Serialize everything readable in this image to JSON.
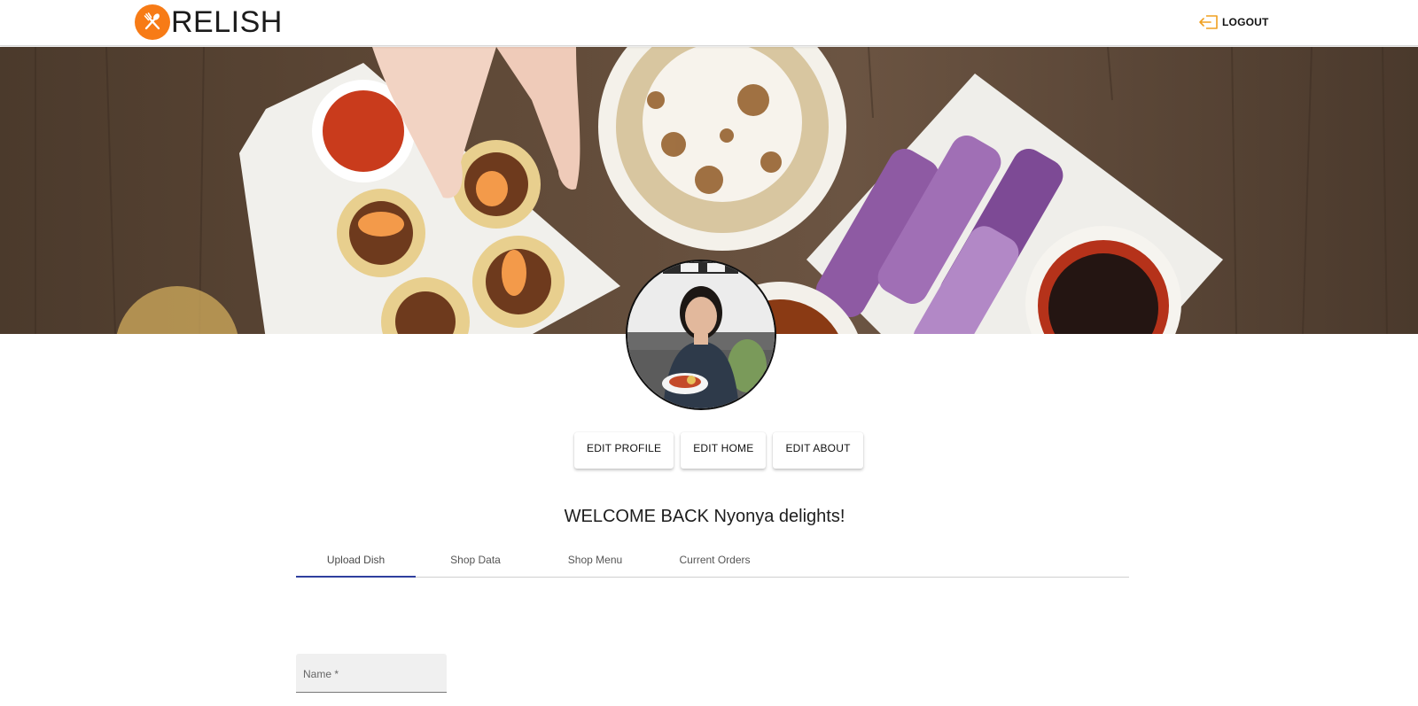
{
  "header": {
    "brand": "RELISH",
    "logout_label": "LOGOUT",
    "accent_color": "#f77b16"
  },
  "profile": {
    "edit_buttons": [
      "EDIT PROFILE",
      "EDIT HOME",
      "EDIT ABOUT"
    ]
  },
  "welcome": "WELCOME BACK Nyonya delights!",
  "tabs": [
    {
      "label": "Upload Dish",
      "active": true
    },
    {
      "label": "Shop Data",
      "active": false
    },
    {
      "label": "Shop Menu",
      "active": false
    },
    {
      "label": "Current Orders",
      "active": false
    }
  ],
  "form": {
    "name_label": "Name *"
  },
  "icons": {
    "logo": "fork-spoon-icon",
    "logout": "logout-icon"
  }
}
